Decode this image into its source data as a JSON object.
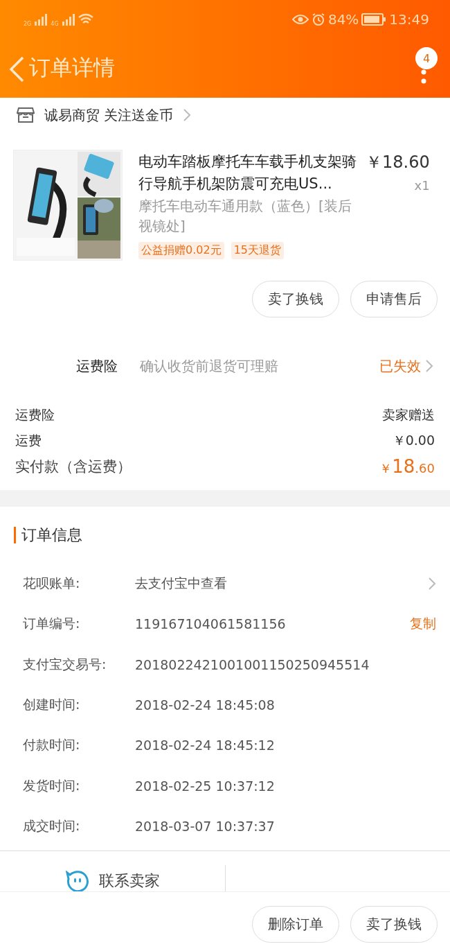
{
  "status_bar": {
    "battery": "84%",
    "time": "13:49",
    "network_1": "2G",
    "network_2": "4G"
  },
  "header": {
    "title": "订单详情",
    "badge": "4"
  },
  "shop": {
    "name": "诚易商贸 关注送金币"
  },
  "product": {
    "image": {
      "kind": "picture"
    },
    "title": "电动车踏板摩托车车载手机支架骑行导航手机架防震可充电US...",
    "price": "￥18.60",
    "quantity": "x1",
    "variant": "摩托车电动车通用款（蓝色）[装后视镜处]",
    "tags": [
      "公益捐赠0.02元",
      "15天退货"
    ]
  },
  "item_buttons": [
    "卖了换钱",
    "申请售后"
  ],
  "insurance": {
    "label": "运费险",
    "description": "确认收货前退货可理赔",
    "status": "已失效"
  },
  "fees": [
    {
      "label": "运费险",
      "value": "卖家赠送",
      "kind": "plain"
    },
    {
      "label": "运费",
      "value": "￥0.00",
      "kind": "plain"
    },
    {
      "label": "实付款（含运费）",
      "currency": "￥",
      "value": "18",
      "cents": ".60",
      "kind": "total"
    }
  ],
  "order_info": {
    "title": "订单信息",
    "rows": [
      {
        "label": "花呗账单:",
        "value": "去支付宝中查看",
        "action": "",
        "kind": "link"
      },
      {
        "label": "订单编号:",
        "value": "119167104061581156",
        "action": "复制",
        "kind": "copy"
      },
      {
        "label": "支付宝交易号:",
        "value": "2018022421001001150250945514",
        "kind": "plain"
      },
      {
        "label": "创建时间:",
        "value": "2018-02-24 18:45:08",
        "kind": "plain"
      },
      {
        "label": "付款时间:",
        "value": "2018-02-24 18:45:12",
        "kind": "plain"
      },
      {
        "label": "发货时间:",
        "value": "2018-02-25 10:37:12",
        "kind": "plain"
      },
      {
        "label": "成交时间:",
        "value": "2018-03-07 10:37:37",
        "kind": "plain"
      }
    ]
  },
  "contact": {
    "label": "联系卖家"
  },
  "bottom_buttons": [
    "删除订单",
    "卖了换钱"
  ]
}
